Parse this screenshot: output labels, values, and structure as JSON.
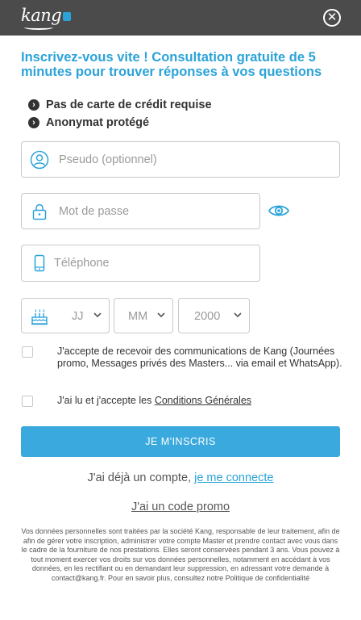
{
  "app": {
    "brand": "kang",
    "close_glyph": "✕"
  },
  "headline": "Inscrivez-vous vite ! Consultation gratuite de 5 minutes pour trouver réponses à vos questions",
  "benefits": [
    {
      "icon": "chevron-right-circle-icon",
      "text": "Pas de carte de crédit requise"
    },
    {
      "icon": "chevron-right-circle-icon",
      "text": "Anonymat protégé"
    }
  ],
  "form": {
    "pseudo": {
      "icon": "user-icon",
      "placeholder": "Pseudo (optionnel)"
    },
    "password": {
      "icon": "lock-icon",
      "placeholder": "Mot de passe",
      "toggle_icon": "eye-icon"
    },
    "phone": {
      "icon": "phone-icon",
      "placeholder": "Téléphone"
    },
    "birthdate": {
      "icon": "birthday-cake-icon",
      "day": "JJ",
      "month": "MM",
      "year": "2000"
    },
    "consent_marketing": "J'accepte de recevoir des communications de Kang (Journées promo, Messages privés des Masters... via email et WhatsApp).",
    "consent_terms_prefix": "J'ai lu et j'accepte les ",
    "consent_terms_link": "Conditions Générales",
    "submit": "JE M'INSCRIS"
  },
  "login": {
    "prefix": "J'ai déjà un compte, ",
    "link": "je me connecte"
  },
  "promo_link": "J'ai un code promo",
  "legal": "Vos données personnelles sont traitées par la société Kang, responsable de leur traitement, afin de afin de gérer votre inscription, administrer votre compte Master et prendre contact avec vous dans le cadre de la fourniture de nos prestations. Elles seront conservées pendant 3 ans. Vous pouvez à tout moment exercer vos droits sur vos données personnelles, notamment en accédant à vos données, en les rectifiant ou en demandant leur suppression, en adressant votre demande à contact@kang.fr. Pour en savoir plus, consultez notre Politique de confidentialité",
  "colors": {
    "accent": "#2ba3d8",
    "topbar": "#4b4b4b",
    "button": "#3aa9dd"
  }
}
